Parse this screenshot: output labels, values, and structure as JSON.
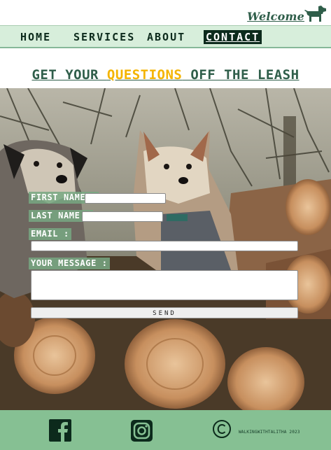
{
  "header": {
    "welcome_text": "Welcome",
    "logo_icon": "dog-silhouette-icon",
    "brand_color": "#2f5e4a"
  },
  "nav": {
    "items": [
      {
        "label": "HOME",
        "active": false
      },
      {
        "label": "SERVICES",
        "active": false
      },
      {
        "label": "ABOUT",
        "active": false
      },
      {
        "label": "CONTACT",
        "active": true
      }
    ],
    "background": "#d7eedb"
  },
  "heading": {
    "part1": "GET YOUR ",
    "highlight": "QUESTIONS",
    "part2": " OFF THE LEASH",
    "highlight_color": "#f4b400"
  },
  "hero_image": {
    "subject": "two terrier dogs sitting on cut logs"
  },
  "form": {
    "first_name_label": "FIRST NAME :",
    "first_name_value": "",
    "last_name_label": "LAST NAME :",
    "last_name_value": "",
    "email_label": "EMAIL :",
    "email_value": "",
    "message_label": "YOUR MESSAGE :",
    "message_value": "",
    "send_label": "SEND"
  },
  "footer": {
    "icons": [
      "facebook-icon",
      "instagram-icon",
      "copyright-icon"
    ],
    "credit": "WALKINGWITHTALITHA 2023",
    "background": "#86c093"
  }
}
